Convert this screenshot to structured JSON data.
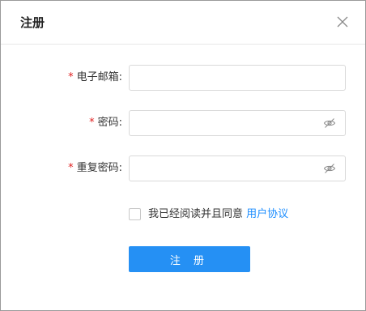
{
  "dialog": {
    "title": "注册",
    "close_icon": "close-icon"
  },
  "form": {
    "required_mark": "*",
    "email": {
      "label": "电子邮箱:",
      "value": "",
      "placeholder": ""
    },
    "password": {
      "label": "密码:",
      "value": "",
      "placeholder": "",
      "toggle_icon": "eye-off-icon"
    },
    "confirm_password": {
      "label": "重复密码:",
      "value": "",
      "placeholder": "",
      "toggle_icon": "eye-off-icon"
    },
    "agreement": {
      "checked": false,
      "text": "我已经阅读并且同意",
      "link_text": "用户协议"
    },
    "submit_label": "注 册"
  },
  "colors": {
    "accent": "#2590f4",
    "link": "#1a8cff",
    "required": "#e02020"
  }
}
